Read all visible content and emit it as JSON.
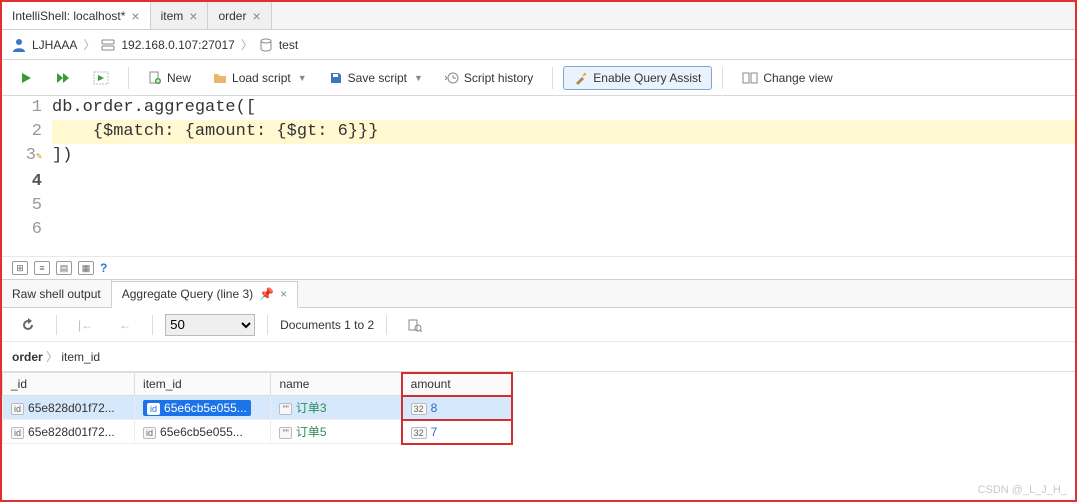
{
  "tabs": [
    {
      "label": "IntelliShell: localhost*",
      "active": true
    },
    {
      "label": "item",
      "active": false
    },
    {
      "label": "order",
      "active": false
    }
  ],
  "breadcrumb": {
    "user": "LJHAAA",
    "host": "192.168.0.107:27017",
    "db": "test"
  },
  "toolbar": {
    "new": "New",
    "load": "Load script",
    "save": "Save script",
    "history": "Script history",
    "assist": "Enable Query Assist",
    "view": "Change view"
  },
  "editor": {
    "lines": [
      "",
      "",
      "db.order.aggregate([",
      "    {$match: {amount: {$gt: 6}}}",
      "])",
      ""
    ],
    "current_line": 4
  },
  "output_tabs": {
    "raw": "Raw shell output",
    "aggregate": "Aggregate Query (line 3)"
  },
  "pager": {
    "page_size": "50",
    "range": "Documents 1 to 2"
  },
  "result_crumb": {
    "collection": "order",
    "field": "item_id"
  },
  "columns": [
    "_id",
    "item_id",
    "name",
    "amount"
  ],
  "rows": [
    {
      "_id": "65e828d01f72...",
      "item_id": "65e6cb5e055...",
      "name": "订单3",
      "amount": "8",
      "selected": true
    },
    {
      "_id": "65e828d01f72...",
      "item_id": "65e6cb5e055...",
      "name": "订单5",
      "amount": "7",
      "selected": false
    }
  ],
  "watermark": "CSDN @_L_J_H_"
}
